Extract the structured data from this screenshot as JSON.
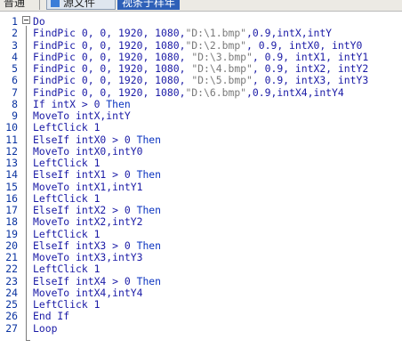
{
  "tabs": {
    "normal_label": "普通",
    "source_label": "源文件",
    "view_label": "视条于样年"
  },
  "code_lines": [
    {
      "n": "1",
      "t": "Do"
    },
    {
      "n": "2",
      "t": "FindPic 0, 0, 1920, 1080,\"D:\\1.bmp\",0.9,intX,intY"
    },
    {
      "n": "3",
      "t": "FindPic 0, 0, 1920, 1080,\"D:\\2.bmp\", 0.9, intX0, intY0"
    },
    {
      "n": "4",
      "t": "FindPic 0, 0, 1920, 1080, \"D:\\3.bmp\", 0.9, intX1, intY1"
    },
    {
      "n": "5",
      "t": "FindPic 0, 0, 1920, 1080, \"D:\\4.bmp\", 0.9, intX2, intY2"
    },
    {
      "n": "6",
      "t": "FindPic 0, 0, 1920, 1080, \"D:\\5.bmp\", 0.9, intX3, intY3"
    },
    {
      "n": "7",
      "t": "FindPic 0, 0, 1920, 1080,\"D:\\6.bmp\",0.9,intX4,intY4"
    },
    {
      "n": "8",
      "t": "If intX > 0 Then"
    },
    {
      "n": "9",
      "t": "MoveTo intX,intY"
    },
    {
      "n": "10",
      "t": "LeftClick 1"
    },
    {
      "n": "11",
      "t": "ElseIf intX0 > 0 Then"
    },
    {
      "n": "12",
      "t": "MoveTo intX0,intY0"
    },
    {
      "n": "13",
      "t": "LeftClick 1"
    },
    {
      "n": "14",
      "t": "ElseIf intX1 > 0 Then"
    },
    {
      "n": "15",
      "t": "MoveTo intX1,intY1"
    },
    {
      "n": "16",
      "t": "LeftClick 1"
    },
    {
      "n": "17",
      "t": "ElseIf intX2 > 0 Then"
    },
    {
      "n": "18",
      "t": "MoveTo intX2,intY2"
    },
    {
      "n": "19",
      "t": "LeftClick 1"
    },
    {
      "n": "20",
      "t": "ElseIf intX3 > 0 Then"
    },
    {
      "n": "21",
      "t": "MoveTo intX3,intY3"
    },
    {
      "n": "22",
      "t": "LeftClick 1"
    },
    {
      "n": "23",
      "t": "ElseIf intX4 > 0 Then"
    },
    {
      "n": "24",
      "t": "MoveTo intX4,intY4"
    },
    {
      "n": "25",
      "t": "LeftClick 1"
    },
    {
      "n": "26",
      "t": "End If"
    },
    {
      "n": "27",
      "t": "Loop"
    }
  ],
  "colors": {
    "line_number": "#0a33a0",
    "keyword": "#0a33c0",
    "string": "#7a7a7a",
    "code": "#1a1aa6"
  }
}
